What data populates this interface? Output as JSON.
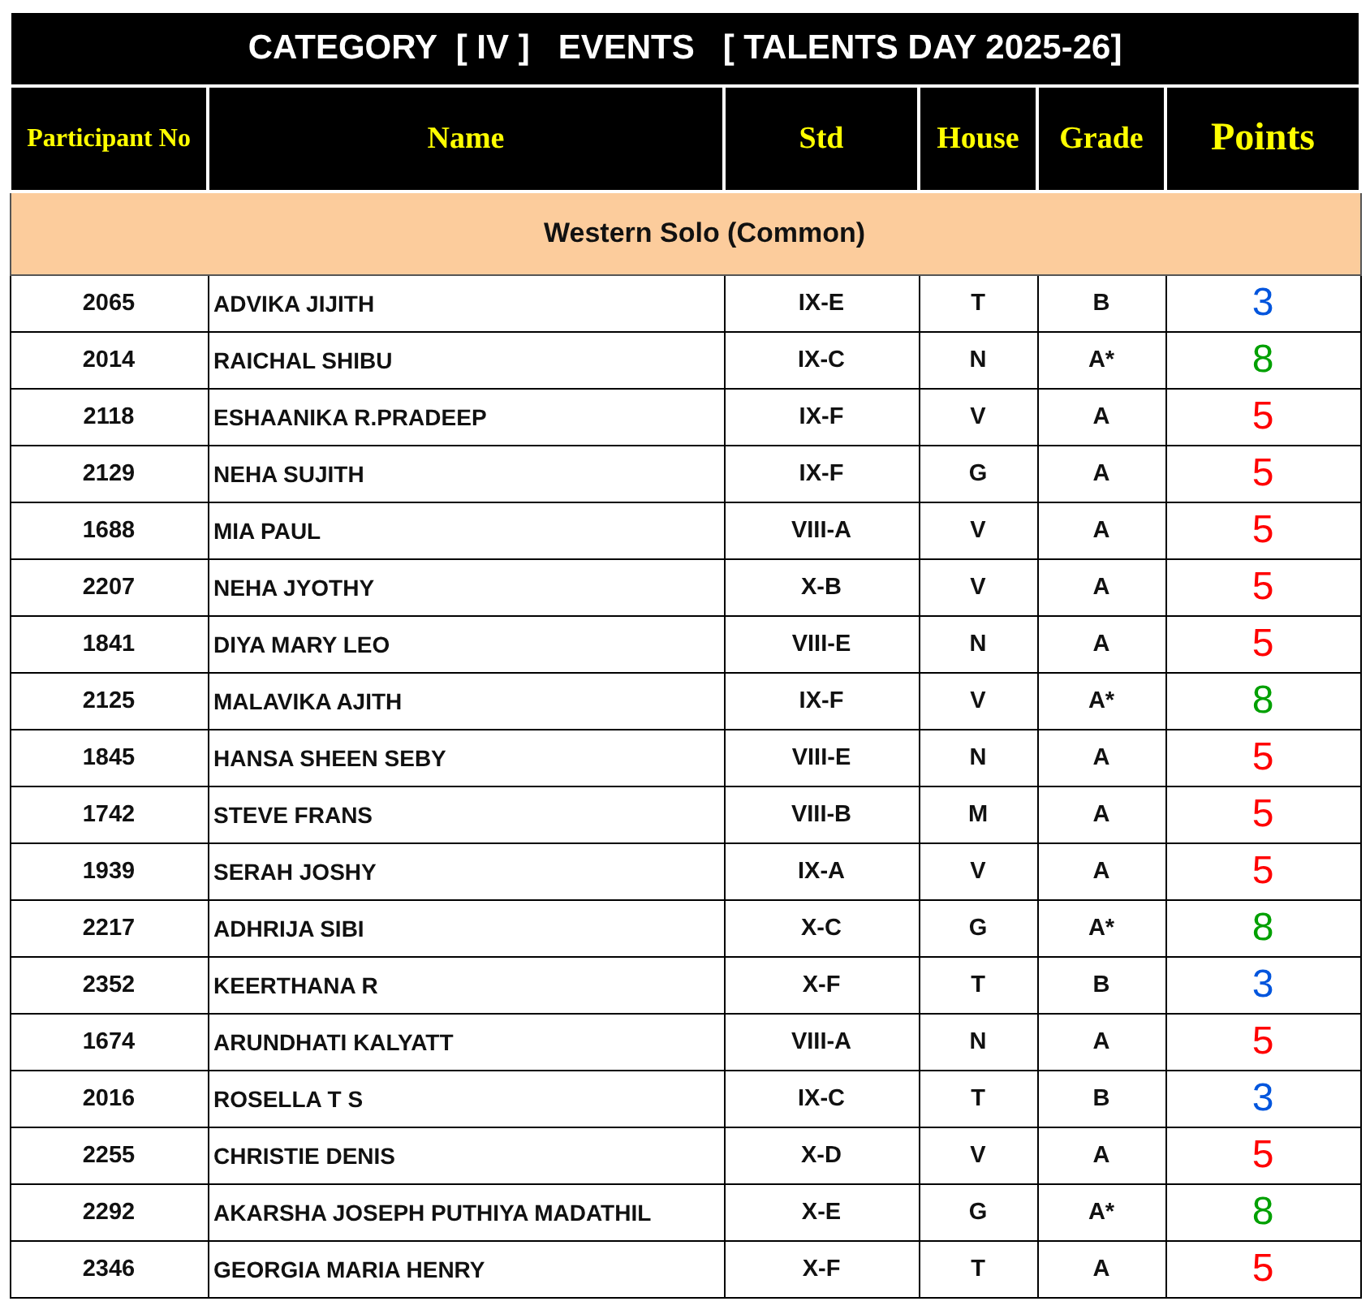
{
  "title": "CATEGORY  [ IV ]   EVENTS   [ TALENTS DAY 2025-26]",
  "columns": [
    {
      "label": "Participant No",
      "kind": "small"
    },
    {
      "label": "Name",
      "kind": "normal"
    },
    {
      "label": "Std",
      "kind": "normal"
    },
    {
      "label": "House",
      "kind": "normal"
    },
    {
      "label": "Grade",
      "kind": "normal"
    },
    {
      "label": "Points",
      "kind": "large"
    }
  ],
  "section": "Western Solo (Common)",
  "rows": [
    {
      "participant_no": "2065",
      "name": "ADVIKA JIJITH",
      "std": "IX-E",
      "house": "T",
      "grade": "B",
      "points": "3",
      "color": "#0055dd"
    },
    {
      "participant_no": "2014",
      "name": "RAICHAL  SHIBU",
      "std": "IX-C",
      "house": "N",
      "grade": "A*",
      "points": "8",
      "color": "#00a000"
    },
    {
      "participant_no": "2118",
      "name": "ESHAANIKA R.PRADEEP",
      "std": "IX-F",
      "house": "V",
      "grade": "A",
      "points": "5",
      "color": "#ff0000"
    },
    {
      "participant_no": "2129",
      "name": "NEHA  SUJITH",
      "std": "IX-F",
      "house": "G",
      "grade": "A",
      "points": "5",
      "color": "#ff0000"
    },
    {
      "participant_no": "1688",
      "name": "MIA PAUL",
      "std": "VIII-A",
      "house": "V",
      "grade": "A",
      "points": "5",
      "color": "#ff0000"
    },
    {
      "participant_no": "2207",
      "name": "NEHA JYOTHY",
      "std": "X-B",
      "house": "V",
      "grade": "A",
      "points": "5",
      "color": "#ff0000"
    },
    {
      "participant_no": "1841",
      "name": "DIYA MARY LEO",
      "std": "VIII-E",
      "house": "N",
      "grade": "A",
      "points": "5",
      "color": "#ff0000"
    },
    {
      "participant_no": "2125",
      "name": "MALAVIKA AJITH",
      "std": "IX-F",
      "house": "V",
      "grade": "A*",
      "points": "8",
      "color": "#00a000"
    },
    {
      "participant_no": "1845",
      "name": "HANSA  SHEEN  SEBY",
      "std": "VIII-E",
      "house": "N",
      "grade": "A",
      "points": "5",
      "color": "#ff0000"
    },
    {
      "participant_no": "1742",
      "name": "STEVE FRANS",
      "std": "VIII-B",
      "house": "M",
      "grade": "A",
      "points": "5",
      "color": "#ff0000"
    },
    {
      "participant_no": "1939",
      "name": "SERAH JOSHY",
      "std": "IX-A",
      "house": "V",
      "grade": "A",
      "points": "5",
      "color": "#ff0000"
    },
    {
      "participant_no": "2217",
      "name": "ADHRIJA  SIBI",
      "std": "X-C",
      "house": "G",
      "grade": "A*",
      "points": "8",
      "color": "#00a000"
    },
    {
      "participant_no": "2352",
      "name": "KEERTHANA R",
      "std": "X-F",
      "house": "T",
      "grade": "B",
      "points": "3",
      "color": "#0055dd"
    },
    {
      "participant_no": "1674",
      "name": "ARUNDHATI KALYATT",
      "std": "VIII-A",
      "house": "N",
      "grade": "A",
      "points": "5",
      "color": "#ff0000"
    },
    {
      "participant_no": "2016",
      "name": "ROSELLA T S",
      "std": "IX-C",
      "house": "T",
      "grade": "B",
      "points": "3",
      "color": "#0055dd"
    },
    {
      "participant_no": "2255",
      "name": "CHRISTIE DENIS",
      "std": "X-D",
      "house": "V",
      "grade": "A",
      "points": "5",
      "color": "#ff0000"
    },
    {
      "participant_no": "2292",
      "name": "AKARSHA JOSEPH PUTHIYA MADATHIL",
      "std": "X-E",
      "house": "G",
      "grade": "A*",
      "points": "8",
      "color": "#00a000"
    },
    {
      "participant_no": "2346",
      "name": "GEORGIA MARIA HENRY",
      "std": "X-F",
      "house": "T",
      "grade": "A",
      "points": "5",
      "color": "#ff0000"
    }
  ]
}
